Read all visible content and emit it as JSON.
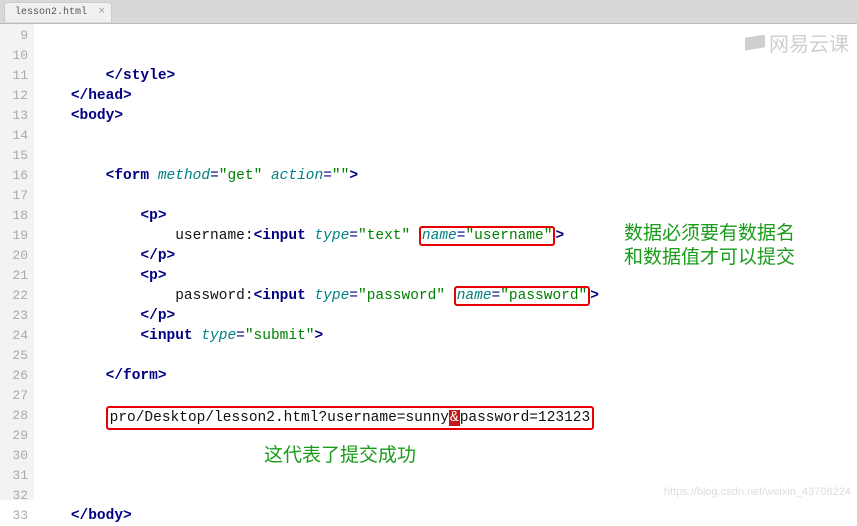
{
  "tab": {
    "filename": "lesson2.html"
  },
  "gutter": {
    "start": 9,
    "end": 33
  },
  "code": {
    "l11": {
      "indent": "        ",
      "close_style": "</style>"
    },
    "l12": {
      "indent": "    ",
      "close_head": "</head>"
    },
    "l13": {
      "indent": "    ",
      "open_body": "<body>"
    },
    "l16": {
      "indent": "        ",
      "form_open": "<form",
      "method_attr": "method",
      "method_val": "\"get\"",
      "action_attr": "action",
      "action_val": "\"\""
    },
    "l18": {
      "indent": "            ",
      "p_open": "<p>"
    },
    "l19": {
      "indent": "                ",
      "label": "username:",
      "input": "<input",
      "type_attr": "type",
      "type_val": "\"text\"",
      "name_attr": "name",
      "name_val": "\"username\""
    },
    "l20": {
      "indent": "            ",
      "p_close": "</p>"
    },
    "l21": {
      "indent": "            ",
      "p_open": "<p>"
    },
    "l22": {
      "indent": "                ",
      "label": "password:",
      "input": "<input",
      "type_attr": "type",
      "type_val": "\"password\"",
      "name_attr": "name",
      "name_val": "\"password\""
    },
    "l23": {
      "indent": "            ",
      "p_close": "</p>"
    },
    "l24": {
      "indent": "            ",
      "input": "<input",
      "type_attr": "type",
      "type_val": "\"submit\""
    },
    "l26": {
      "indent": "        ",
      "form_close": "</form>"
    },
    "l28": {
      "indent": "        ",
      "url_before": "pro/Desktop/lesson2.html?username=sunny",
      "amp": "&",
      "url_after": "password=123123"
    },
    "l33": {
      "indent": "    ",
      "close_body": "</body>"
    }
  },
  "annotations": {
    "right1": "数据必须要有数据名",
    "right2": "和数据值才可以提交",
    "bottom": "这代表了提交成功"
  },
  "watermark": {
    "text": "网易云课",
    "blog": "https://blog.csdn.net/weixin_43706224"
  }
}
